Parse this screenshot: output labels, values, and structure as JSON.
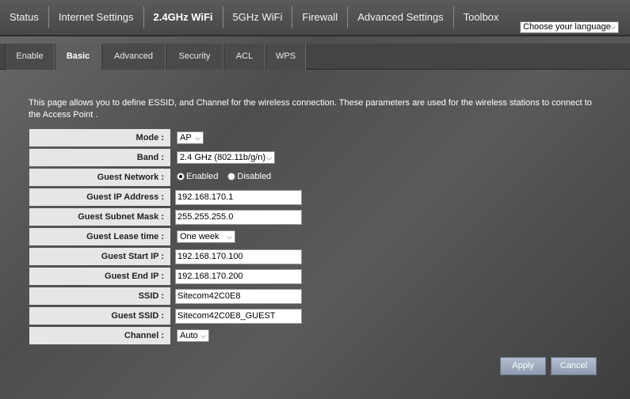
{
  "topnav": {
    "items": [
      "Status",
      "Internet Settings",
      "2.4GHz WiFi",
      "5GHz WiFi",
      "Firewall",
      "Advanced Settings",
      "Toolbox"
    ],
    "active_index": 2,
    "language_select": "Choose your language"
  },
  "subtabs": {
    "items": [
      "Enable",
      "Basic",
      "Advanced",
      "Security",
      "ACL",
      "WPS"
    ],
    "active_index": 1
  },
  "description": "This page allows you to define ESSID, and Channel for the wireless connection. These parameters are used for the wireless stations to connect to the Access Point .",
  "form": {
    "mode": {
      "label": "Mode :",
      "value": "AP"
    },
    "band": {
      "label": "Band :",
      "value": "2.4 GHz (802.11b/g/n)"
    },
    "guest_network": {
      "label": "Guest Network :",
      "enabled_label": "Enabled",
      "disabled_label": "Disabled",
      "selected": "Enabled"
    },
    "guest_ip": {
      "label": "Guest IP Address :",
      "value": "192.168.170.1"
    },
    "guest_subnet": {
      "label": "Guest Subnet Mask :",
      "value": "255.255.255.0"
    },
    "guest_lease": {
      "label": "Guest Lease time :",
      "value": "One week"
    },
    "guest_start_ip": {
      "label": "Guest Start IP :",
      "value": "192.168.170.100"
    },
    "guest_end_ip": {
      "label": "Guest End IP :",
      "value": "192.168.170.200"
    },
    "ssid": {
      "label": "SSID :",
      "value": "Sitecom42C0E8"
    },
    "guest_ssid": {
      "label": "Guest SSID :",
      "value": "Sitecom42C0E8_GUEST"
    },
    "channel": {
      "label": "Channel :",
      "value": "Auto"
    }
  },
  "buttons": {
    "apply": "Apply",
    "cancel": "Cancel"
  },
  "icons": {
    "dropdown": "chevron-down-icon"
  }
}
